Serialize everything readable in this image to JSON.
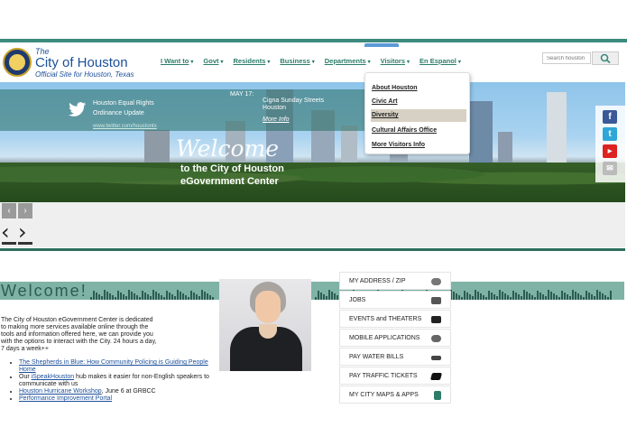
{
  "brand": {
    "the": "The",
    "name": "City of Houston",
    "tagline": "Official Site for Houston, Texas"
  },
  "nav": {
    "items": [
      "I Want to",
      "Govt",
      "Residents",
      "Business",
      "Departments",
      "Visitors",
      "En Espanol"
    ]
  },
  "search": {
    "placeholder": "Search houston"
  },
  "dropdown": {
    "items": [
      "About Houston",
      "Civic Art",
      "Diversity",
      "Cultural Affairs Office",
      "More Visitors Info"
    ],
    "active_index": 2
  },
  "hero": {
    "tweet_line1": "Houston Equal Rights",
    "tweet_line2": "Ordinance Update",
    "tweet_link": "www.twitter.com/houstontx",
    "event_date": "MAY 17:",
    "event_line1": "Cigna Sunday Streets",
    "event_line2": "Houston",
    "event_more": "More Info",
    "welcome": "Welcome",
    "welcome_sub1": "to the City of Houston",
    "welcome_sub2": "eGovernment Center"
  },
  "social": [
    "facebook-icon",
    "twitter-icon",
    "youtube-icon",
    "email-icon"
  ],
  "slider": {
    "prev": "‹",
    "next": "›"
  },
  "welcome_banner": "Welcome!",
  "intro": "The City of Houston eGovernment Center is dedicated to making more services available online through the tools and information offered here, we can provide you with the options to interact with the City. 24 hours a day, 7 days a week++",
  "bullets": [
    {
      "link": "The Shepherds in Blue: How Community Policing is Guiding People Home",
      "rest": ""
    },
    {
      "pre": "Our ",
      "link": "iSpeakHouston",
      "rest": " hub makes it easier for non-English speakers to communicate with us"
    },
    {
      "link": "Houston Hurricane Workshop",
      "rest": ", June 6 at GRBCC"
    },
    {
      "link": "Performance Improvement Portal",
      "rest": ""
    }
  ],
  "quick_links": [
    "MY ADDRESS / ZIP",
    "JOBS",
    "EVENTS and THEATERS",
    "MOBILE APPLICATIONS",
    "PAY WATER BILLS",
    "PAY TRAFFIC TICKETS",
    "MY CITY MAPS & APPS"
  ],
  "colors": {
    "accent": "#2c7d6a",
    "brand_blue": "#1c4f9a",
    "banner": "#7fb3a6"
  }
}
